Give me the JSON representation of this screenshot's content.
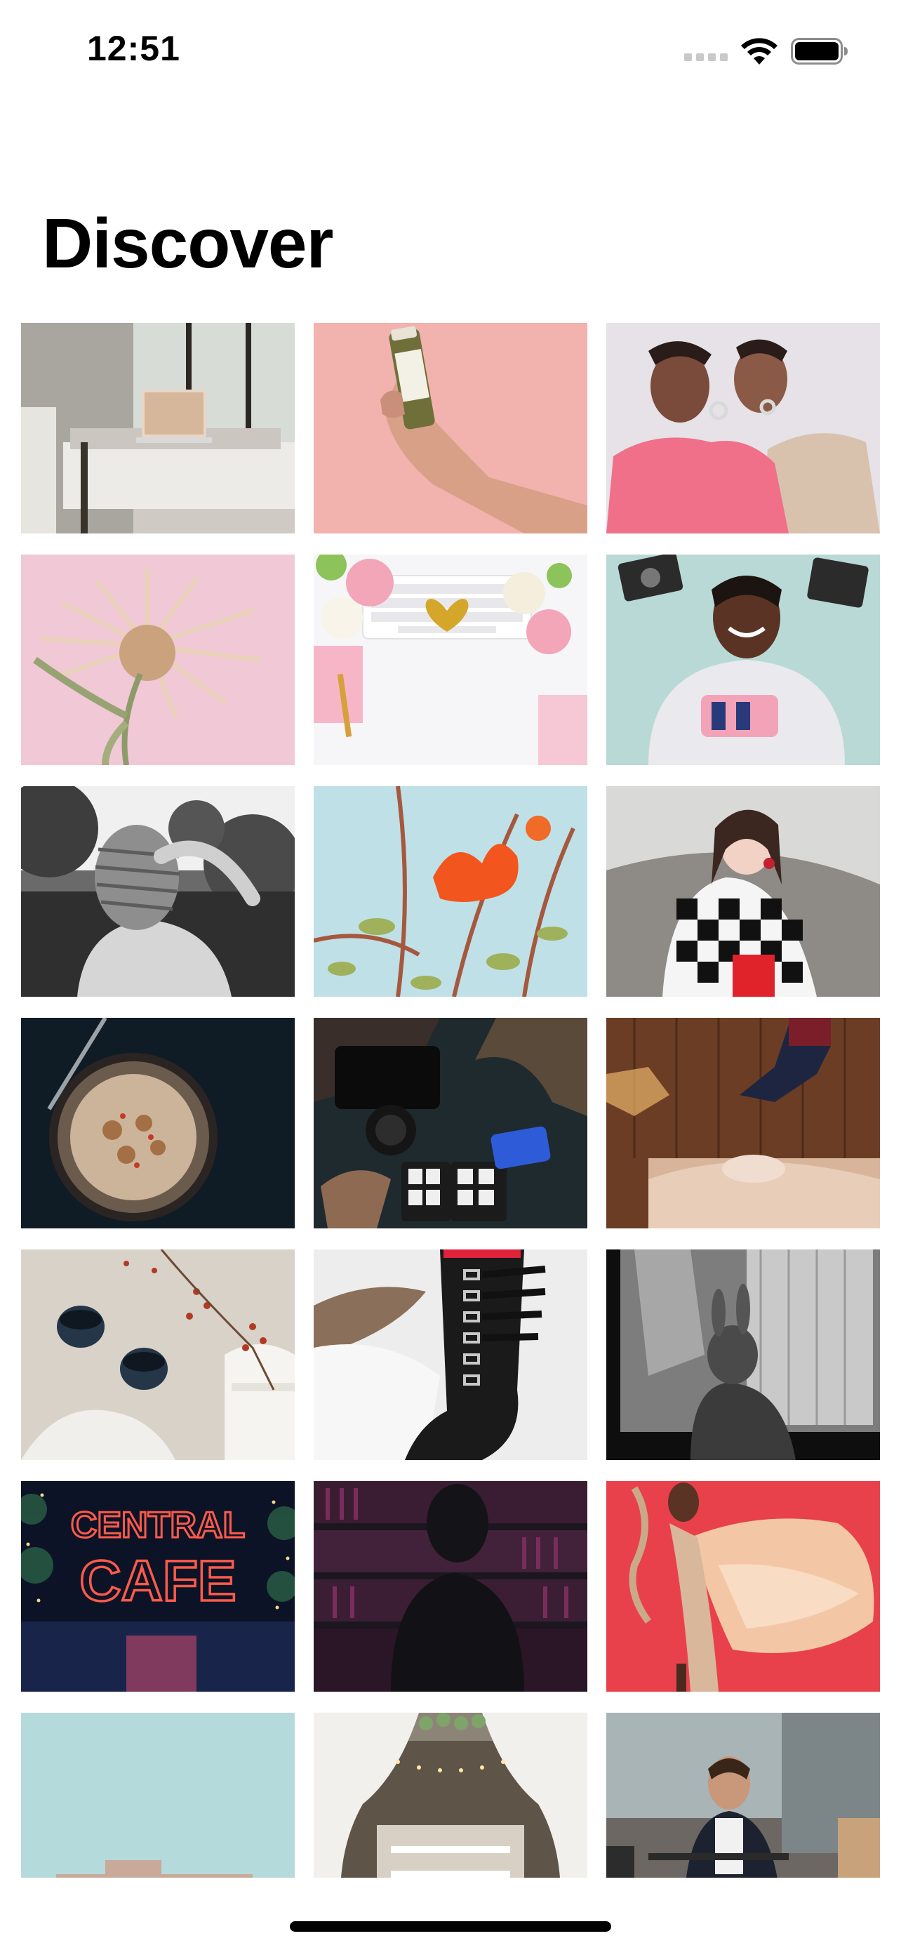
{
  "status_bar": {
    "time": "12:51",
    "signal_icon": "cellular-signal-icon",
    "wifi_icon": "wifi-icon",
    "battery_icon": "battery-icon"
  },
  "header": {
    "title": "Discover"
  },
  "photos": [
    {
      "id": "workspace-laptop",
      "alt": "Laptop on a white bench"
    },
    {
      "id": "juice-bottle",
      "alt": "Hand holding a juice bottle"
    },
    {
      "id": "pink-fashion",
      "alt": "Two models in pink outfits"
    },
    {
      "id": "dried-flower",
      "alt": "Dried protea flower on pink"
    },
    {
      "id": "desk-flatlay",
      "alt": "Keyboard with peonies flat lay"
    },
    {
      "id": "polaroid-camera",
      "alt": "Woman holding instant cameras"
    },
    {
      "id": "covered-face",
      "alt": "Person with wrapped head"
    },
    {
      "id": "orange-flowers",
      "alt": "Orange flowers against sky"
    },
    {
      "id": "checkered-coat",
      "alt": "Woman in checkered coat"
    },
    {
      "id": "pasta-bowl",
      "alt": "Bowl of pasta"
    },
    {
      "id": "camera-gear",
      "alt": "Camera gear and memory cards"
    },
    {
      "id": "jump-bed",
      "alt": "Person jumping on a bed"
    },
    {
      "id": "cake-cups",
      "alt": "Cake and tea cups"
    },
    {
      "id": "boots-snow",
      "alt": "Buckled boots in snow"
    },
    {
      "id": "bw-rabbit",
      "alt": "Black and white rabbit mask"
    },
    {
      "id": "central-cafe",
      "alt": "Central Cafe neon sign"
    },
    {
      "id": "library-shadow",
      "alt": "Silhouette in a library"
    },
    {
      "id": "red-dress",
      "alt": "Dancer with flowing fabric"
    },
    {
      "id": "building-sky",
      "alt": "Building against blue sky"
    },
    {
      "id": "wedding-venue",
      "alt": "Decorated wedding venue"
    },
    {
      "id": "cafe-man",
      "alt": "Man at an outdoor cafe"
    }
  ],
  "photo_text": {
    "neon_sign_line1": "CENTRAL",
    "neon_sign_line2": "CAFE"
  },
  "colors": {
    "background": "#ffffff",
    "text": "#000000",
    "neon": "#ff5a4a"
  }
}
